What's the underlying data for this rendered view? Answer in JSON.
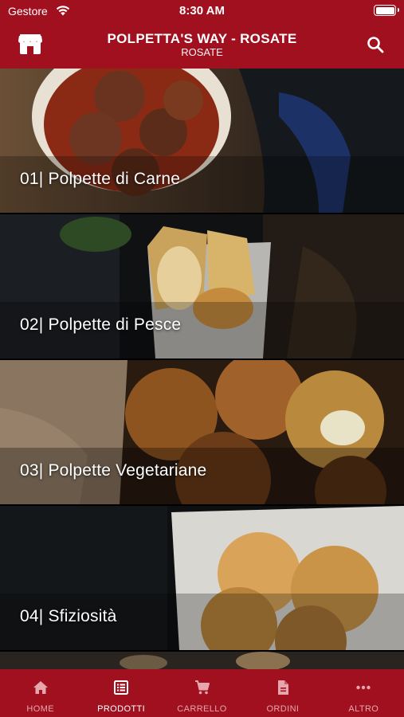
{
  "status_bar": {
    "carrier": "Gestore",
    "time": "8:30 AM"
  },
  "header": {
    "title": "POLPETTA'S WAY - ROSATE",
    "subtitle": "ROSATE",
    "left_icon": "store-icon",
    "right_icon": "search-icon"
  },
  "categories": [
    {
      "label": "01| Polpette di Carne"
    },
    {
      "label": "02| Polpette di Pesce"
    },
    {
      "label": "03| Polpette Vegetariane"
    },
    {
      "label": "04| Sfiziosità"
    }
  ],
  "tabbar": {
    "items": [
      {
        "label": "HOME",
        "icon": "home-icon",
        "active": false
      },
      {
        "label": "PRODOTTI",
        "icon": "list-icon",
        "active": true
      },
      {
        "label": "CARRELLO",
        "icon": "cart-icon",
        "active": false
      },
      {
        "label": "ORDINI",
        "icon": "document-icon",
        "active": false
      },
      {
        "label": "ALTRO",
        "icon": "more-icon",
        "active": false
      }
    ]
  },
  "colors": {
    "brand": "#a0101f",
    "tab_active": "#ffffff",
    "tab_inactive": "#e7a6ac"
  }
}
